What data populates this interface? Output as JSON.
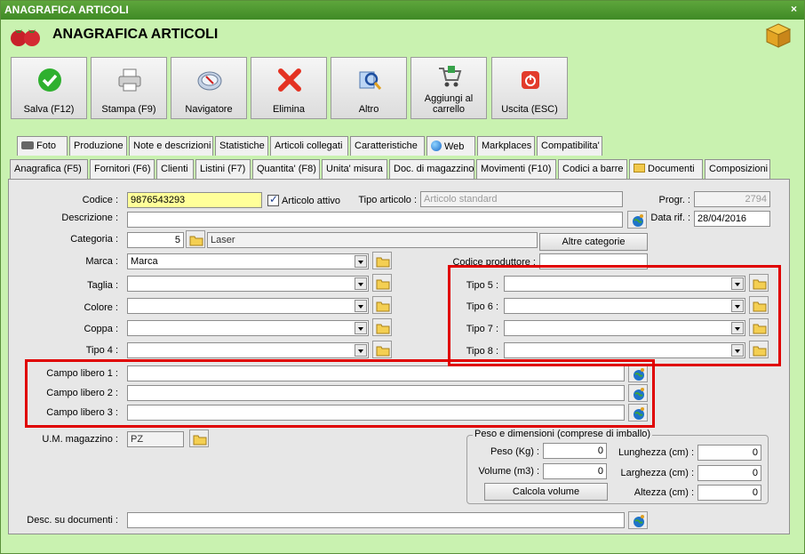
{
  "window": {
    "title": "ANAGRAFICA ARTICOLI",
    "close": "×"
  },
  "header": {
    "title": "ANAGRAFICA ARTICOLI"
  },
  "toolbar": {
    "salva": "Salva (F12)",
    "stampa": "Stampa (F9)",
    "navigatore": "Navigatore",
    "elimina": "Elimina",
    "altro": "Altro",
    "aggiungi": "Aggiungi al carrello",
    "uscita": "Uscita (ESC)"
  },
  "tabs_top": [
    "Foto",
    "Produzione",
    "Note e descrizioni",
    "Statistiche",
    "Articoli collegati",
    "Caratteristiche",
    "Web",
    "Markplaces",
    "Compatibilita'"
  ],
  "tabs_bottom": [
    "Anagrafica (F5)",
    "Fornitori (F6)",
    "Clienti",
    "Listini (F7)",
    "Quantita' (F8)",
    "Unita' misura",
    "Doc. di magazzino",
    "Movimenti (F10)",
    "Codici a barre",
    "Documenti",
    "Composizioni"
  ],
  "form": {
    "codice_label": "Codice :",
    "codice_value": "9876543293",
    "attivo_label": "Articolo attivo",
    "tipo_label": "Tipo articolo :",
    "tipo_placeholder": "Articolo standard",
    "progr_label": "Progr. :",
    "progr_value": "2794",
    "descr_label": "Descrizione :",
    "datarif_label": "Data rif. :",
    "datarif_value": "28/04/2016",
    "categoria_label": "Categoria :",
    "categoria_value": "5",
    "categoria_name": "Laser",
    "altre_cat": "Altre categorie",
    "marca_label": "Marca :",
    "marca_value": "Marca",
    "codprod_label": "Codice produttore :",
    "taglia_label": "Taglia :",
    "colore_label": "Colore :",
    "coppa_label": "Coppa :",
    "tipo4_label": "Tipo 4 :",
    "tipo5_label": "Tipo 5 :",
    "tipo6_label": "Tipo 6 :",
    "tipo7_label": "Tipo 7 :",
    "tipo8_label": "Tipo 8 :",
    "cl1_label": "Campo libero 1 :",
    "cl2_label": "Campo libero 2 :",
    "cl3_label": "Campo libero 3 :",
    "um_label": "U.M. magazzino :",
    "um_value": "PZ",
    "peso_group": "Peso e dimensioni (comprese di imballo)",
    "peso_label": "Peso (Kg) :",
    "peso_value": "0",
    "volume_label": "Volume (m3) :",
    "volume_value": "0",
    "calcola": "Calcola volume",
    "lunghezza_label": "Lunghezza (cm) :",
    "lunghezza_value": "0",
    "larghezza_label": "Larghezza (cm) :",
    "larghezza_value": "0",
    "altezza_label": "Altezza (cm) :",
    "altezza_value": "0",
    "desc_doc_label": "Desc. su documenti :"
  },
  "colors": {
    "accent_green": "#c9f2b0",
    "title_green": "#4a9a2e",
    "highlight_red": "#e00000",
    "yellow_field": "#ffff99"
  }
}
